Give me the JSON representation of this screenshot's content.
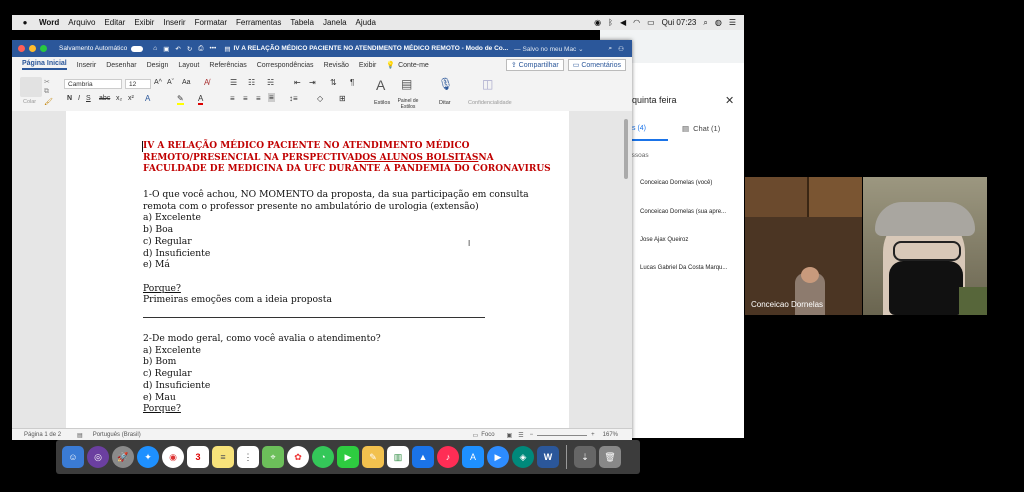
{
  "menubar": {
    "app": "Word",
    "items": [
      "Arquivo",
      "Editar",
      "Exibir",
      "Inserir",
      "Formatar",
      "Ferramentas",
      "Tabela",
      "Janela",
      "Ajuda"
    ],
    "clock": "Qui 07:23"
  },
  "word": {
    "autosave_label": "Salvamento Automático",
    "title": "IV A RELAÇÃO MÉDICO PACIENTE NO ATENDIMENTO MÉDICO REMOTO - Modo de Co...",
    "save_status": "— Salvo no meu Mac ⌄",
    "tabs": [
      "Página Inicial",
      "Inserir",
      "Desenhar",
      "Design",
      "Layout",
      "Referências",
      "Correspondências",
      "Revisão",
      "Exibir"
    ],
    "tellme": "Conte-me",
    "share_label": "Compartilhar",
    "comments_label": "Comentários",
    "ribbon": {
      "paste_label": "Colar",
      "font_name": "Cambria",
      "font_size": "12",
      "styles_label": "Estilos",
      "styles_pane_label": "Painel de Estilos",
      "dictate_label": "Ditar",
      "sensitivity_label": "Confidencialidade"
    },
    "document": {
      "heading_lines": [
        "IV  A  RELAÇÃO  MÉDICO  PACIENTE  NO  ATENDIMENTO  MÉDICO",
        "REMOTO/PRESENCIAL  NA  PERSPECTIVA",
        "DOS ALUNOS BOLSITAS",
        "NA",
        "FACULDADE DE MEDICINA DA UFC DURANTE A PANDEMIA DO CORONAVIRUS"
      ],
      "q1": [
        "1-O que você achou, NO MOMENTO da proposta, da sua participação em consulta",
        "remota com o professor presente no ambulatório de urologia (extensão)",
        "a) Excelente",
        "b) Boa",
        "c) Regular",
        "d) Insuficiente",
        "e) Má"
      ],
      "porque1": "Porque?",
      "primeiras": "Primeiras emoções com a ideia proposta",
      "q2": [
        "2-De modo geral, como você avalia o atendimento?",
        "a) Excelente",
        "b) Bom",
        "c) Regular",
        "d) Insuficiente",
        "e) Mau"
      ],
      "porque2": "Porque?"
    },
    "status": {
      "page": "Página 1 de 2",
      "language": "Português (Brasil)",
      "focus": "Foco",
      "zoom": "167%"
    }
  },
  "meet": {
    "day": "quinta feira",
    "people_tab": "s (4)",
    "chat_tab": "Chat (1)",
    "section": "essoas",
    "participants": [
      "Conceicao Dornelas (você)",
      "Conceicao Dornelas (sua apre...",
      "Jose Ajax Queiroz",
      "Lucas Gabriel Da Costa Marqu..."
    ],
    "video_name": "Conceicao Dornelas"
  },
  "dock": {
    "calendar_day": "3"
  },
  "colors": {
    "word_blue": "#2b579a",
    "heading_red": "#c00000"
  }
}
